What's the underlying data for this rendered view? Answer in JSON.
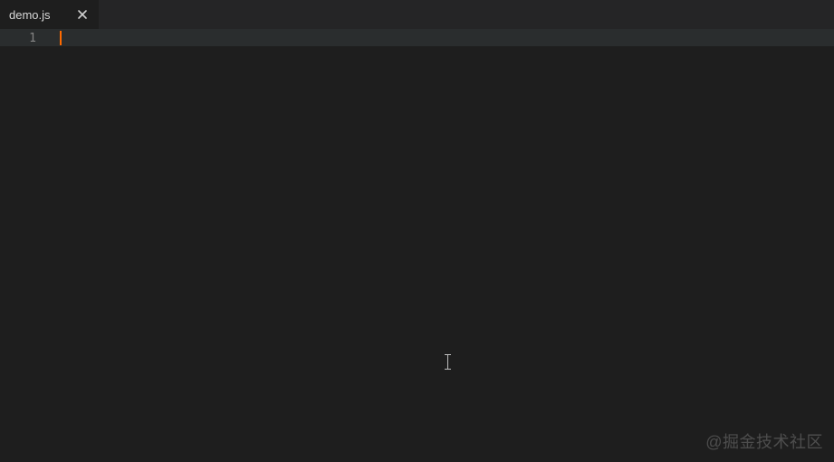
{
  "tabs": [
    {
      "label": "demo.js",
      "active": true
    }
  ],
  "editor": {
    "line_numbers": [
      "1"
    ],
    "content": "",
    "cursor_line": 1,
    "cursor_col": 1
  },
  "watermark": "@掘金技术社区",
  "colors": {
    "background": "#1e1e1e",
    "tabbar": "#252526",
    "cursor": "#ff6a00",
    "line_highlight": "#2a2d2e"
  }
}
